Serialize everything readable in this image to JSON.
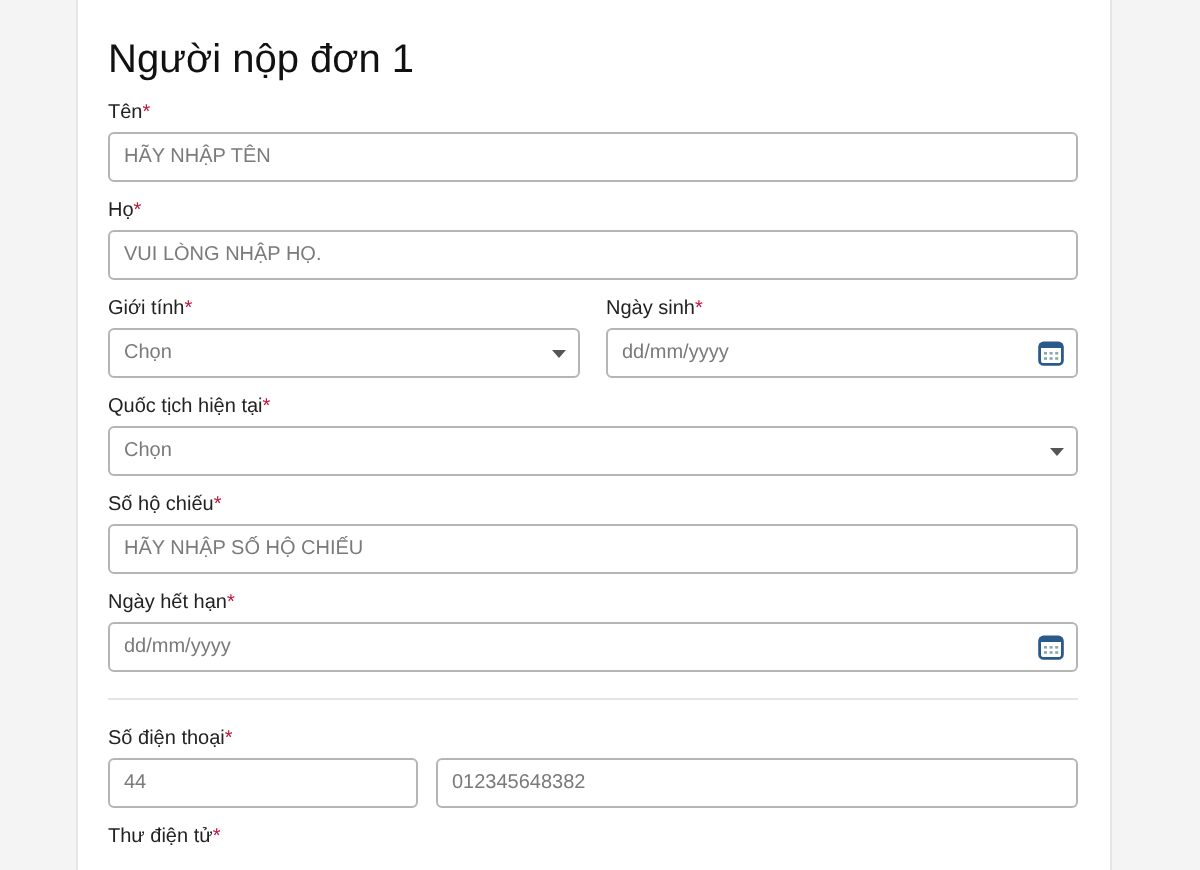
{
  "title": "Người nộp đơn 1",
  "rows": [
    {
      "kind": "fields",
      "fields": [
        {
          "label": "Tên",
          "required_mark": "*",
          "inputs": [
            {
              "kind": "text",
              "placeholder": "HÃY NHẬP TÊN"
            }
          ]
        }
      ]
    },
    {
      "kind": "fields",
      "fields": [
        {
          "label": "Họ",
          "required_mark": "*",
          "inputs": [
            {
              "kind": "text",
              "placeholder": "VUI LÒNG NHẬP HỌ."
            }
          ]
        }
      ]
    },
    {
      "kind": "fields",
      "fields": [
        {
          "label": "Giới tính",
          "required_mark": "*",
          "inputs": [
            {
              "kind": "select",
              "placeholder": "Chọn"
            }
          ]
        },
        {
          "label": "Ngày sinh",
          "required_mark": "*",
          "inputs": [
            {
              "kind": "date",
              "placeholder": "dd/mm/yyyy"
            }
          ]
        }
      ]
    },
    {
      "kind": "fields",
      "fields": [
        {
          "label": "Quốc tịch hiện tại",
          "required_mark": "*",
          "inputs": [
            {
              "kind": "select",
              "placeholder": "Chọn"
            }
          ]
        }
      ]
    },
    {
      "kind": "fields",
      "fields": [
        {
          "label": "Số hộ chiếu",
          "required_mark": "*",
          "inputs": [
            {
              "kind": "text",
              "placeholder": "HÃY NHẬP SỐ HỘ CHIẾU"
            }
          ]
        }
      ]
    },
    {
      "kind": "fields",
      "fields": [
        {
          "label": "Ngày hết hạn",
          "required_mark": "*",
          "inputs": [
            {
              "kind": "date",
              "placeholder": "dd/mm/yyyy"
            }
          ]
        }
      ]
    },
    {
      "kind": "divider"
    },
    {
      "kind": "fields",
      "fields": [
        {
          "label": "Số điện thoại",
          "required_mark": "*",
          "inputs": [
            {
              "kind": "code",
              "placeholder": "44"
            },
            {
              "kind": "text",
              "placeholder": "012345648382"
            }
          ]
        }
      ]
    },
    {
      "kind": "fields",
      "fields": [
        {
          "label": "Thư điện tử",
          "required_mark": "*"
        }
      ]
    }
  ]
}
